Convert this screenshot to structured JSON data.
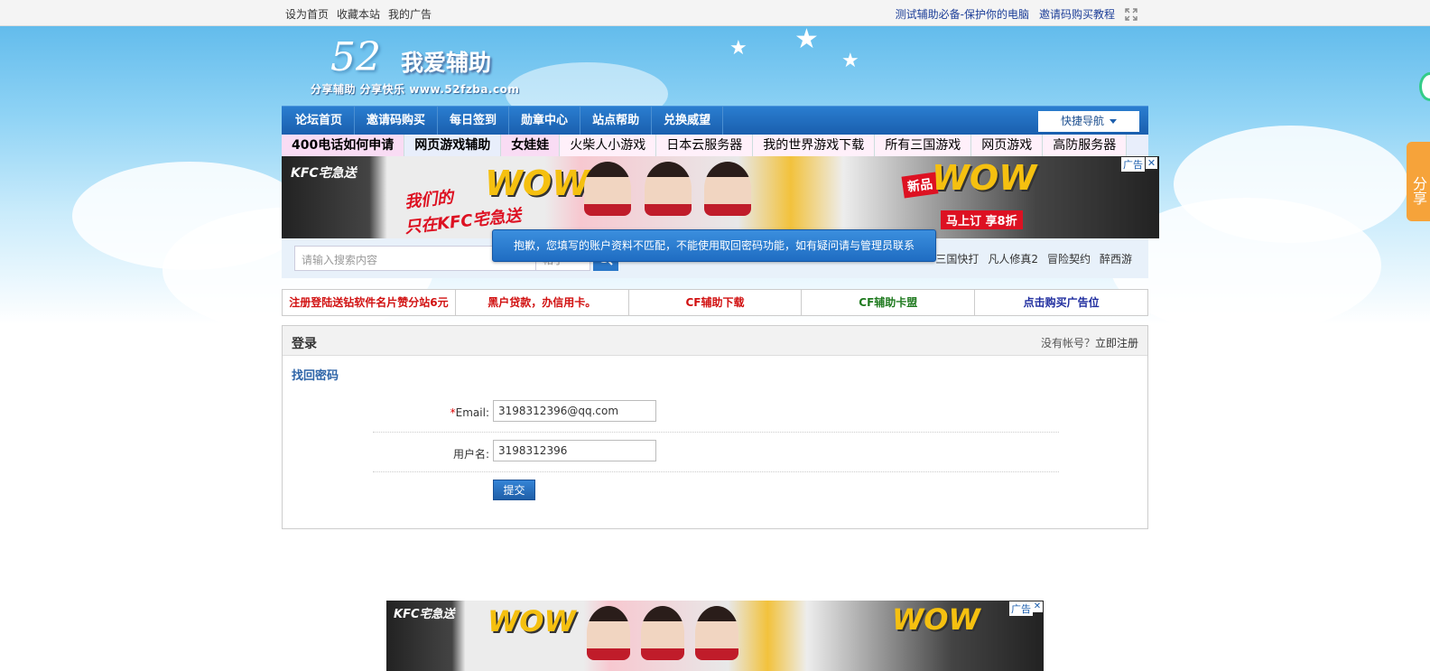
{
  "topbar": {
    "left_links": [
      "设为首页",
      "收藏本站",
      "我的广告"
    ],
    "right_links": [
      "测试辅助必备-保护你的电脑",
      "邀请码购买教程"
    ]
  },
  "logo": {
    "number": "52",
    "title": "我爱辅助",
    "slogan": "分享辅助  分享快乐  www.52fzba.com"
  },
  "nav": {
    "items": [
      "论坛首页",
      "邀请码购买",
      "每日签到",
      "勋章中心",
      "站点帮助",
      "兑换威望"
    ],
    "quick_nav": "快捷导航"
  },
  "links_strip": [
    "400电话如何申请",
    "网页游戏辅助",
    "女娃娃",
    "火柴人小游戏",
    "日本云服务器",
    "我的世界游戏下载",
    "所有三国游戏",
    "网页游戏",
    "高防服务器"
  ],
  "ad_top": {
    "brand": "KFC宅急送",
    "slogan1": "我们的",
    "wow": "WOW",
    "slogan2": "只在KFC宅急送",
    "new_badge": "新品",
    "discount": "马上订 享8折",
    "label": "广告",
    "close": "✕"
  },
  "search": {
    "placeholder": "请输入搜索内容",
    "type_label": "帖子",
    "hot_words": [
      "三国快打",
      "凡人修真2",
      "冒险契约",
      "醉西游"
    ]
  },
  "error_tip": "抱歉，您填写的账户资料不匹配，不能使用取回密码功能，如有疑问请与管理员联系",
  "text_ads": [
    {
      "text": "注册登陆送钻软件名片赞分站6元",
      "color": "#d11111"
    },
    {
      "text": "黑户贷款，办信用卡。",
      "color": "#d11111"
    },
    {
      "text": "CF辅助下载",
      "color": "#d11111"
    },
    {
      "text": "CF辅助卡盟",
      "color": "#1f7a1f"
    },
    {
      "text": "点击购买广告位",
      "color": "#1f2d9f"
    }
  ],
  "login": {
    "title": "登录",
    "register_prompt": "没有帐号？",
    "register_link": "立即注册",
    "subtitle": "找回密码",
    "email_required": "*",
    "email_label": "Email:",
    "email_value": "3198312396@qq.com",
    "username_label": "用户名:",
    "username_value": "3198312396",
    "submit_label": "提交"
  },
  "ad_bottom": {
    "brand": "KFC宅急送",
    "label": "广告",
    "close": "✕"
  },
  "share": "分享"
}
